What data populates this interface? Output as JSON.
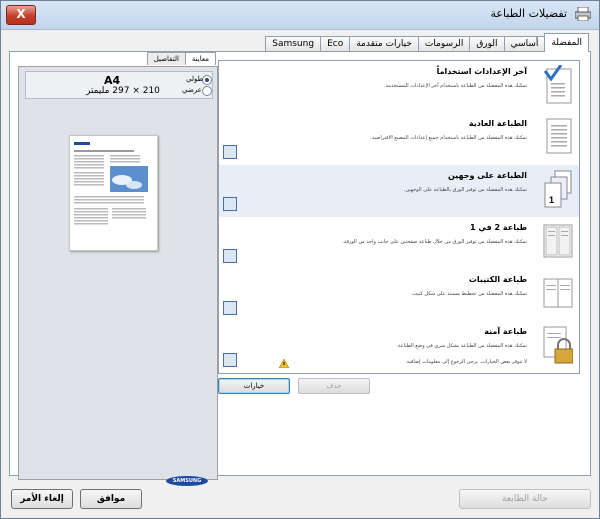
{
  "window": {
    "title": "تفضيلات الطباعة",
    "close_label": "X"
  },
  "tabs": [
    "المفضلة",
    "أساسي",
    "الورق",
    "الرسومات",
    "خيارات متقدمة",
    "Eco",
    "Samsung"
  ],
  "preview": {
    "tabs": [
      "معاينة",
      "التفاصيل"
    ],
    "paper_name": "A4",
    "paper_size": "210 × 297 مليمتر",
    "orientation_options": [
      "طولي",
      "عرضي"
    ],
    "brand": "SAMSUNG"
  },
  "favorites": [
    {
      "title": "آخر الإعدادات استخداماً",
      "desc": "تمكنك هذه المفضلة من الطباعة باستخدام آخر الإعدادات المستخدمة."
    },
    {
      "title": "الطباعة العادية",
      "desc": "تمكنك هذه المفضلة من الطباعة باستخدام جميع إعدادات المصنع الافتراضية."
    },
    {
      "title": "الطباعة على وجهين",
      "desc": "تمكنك هذه المفضلة من توفير الورق بالطباعة على الوجهين."
    },
    {
      "title": "طباعة 2 في 1",
      "desc": "تمكنك هذه المفضلة من توفير الورق من خلال طباعة صفحتين على جانب واحد من الورقة."
    },
    {
      "title": "طباعة الكتيبات",
      "desc": "تمكنك هذه المفضلة من تخطيط مستند على شكل كتيب."
    },
    {
      "title": "طباعة آمنة",
      "desc": "تمكنك هذه المفضلة من الطباعة بشكل سري في وضع الطباعة.",
      "warning": "لا تتوفر بعض الخيارات. يرجى الرجوع إلى معلومات إضافية."
    }
  ],
  "buttons": {
    "options": "خيارات",
    "delete": "حذف",
    "ok": "موافق",
    "cancel": "إلغاء الأمر",
    "printer_status": "حالة الطابعة"
  }
}
